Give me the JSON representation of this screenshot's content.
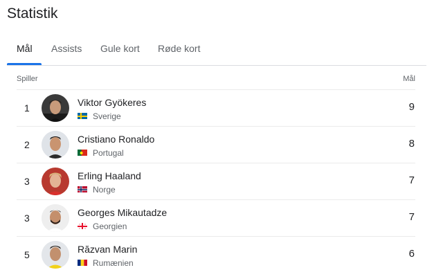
{
  "title": "Statistik",
  "tabs": [
    {
      "label": "Mål",
      "active": true
    },
    {
      "label": "Assists",
      "active": false
    },
    {
      "label": "Gule kort",
      "active": false
    },
    {
      "label": "Røde kort",
      "active": false
    }
  ],
  "table": {
    "col_player": "Spiller",
    "col_goals": "Mål",
    "rows": [
      {
        "rank": "1",
        "name": "Viktor Gyökeres",
        "country": "Sverige",
        "flag": "flag-sweden-icon",
        "goals": "9"
      },
      {
        "rank": "2",
        "name": "Cristiano Ronaldo",
        "country": "Portugal",
        "flag": "flag-portugal-icon",
        "goals": "8"
      },
      {
        "rank": "3",
        "name": "Erling Haaland",
        "country": "Norge",
        "flag": "flag-norway-icon",
        "goals": "7"
      },
      {
        "rank": "3",
        "name": "Georges Mikautadze",
        "country": "Georgien",
        "flag": "flag-georgia-icon",
        "goals": "7"
      },
      {
        "rank": "5",
        "name": "Răzvan Marin",
        "country": "Rumænien",
        "flag": "flag-romania-icon",
        "goals": "6"
      }
    ]
  },
  "colors": {
    "accent": "#1a73e8",
    "divider": "#dadce0"
  }
}
